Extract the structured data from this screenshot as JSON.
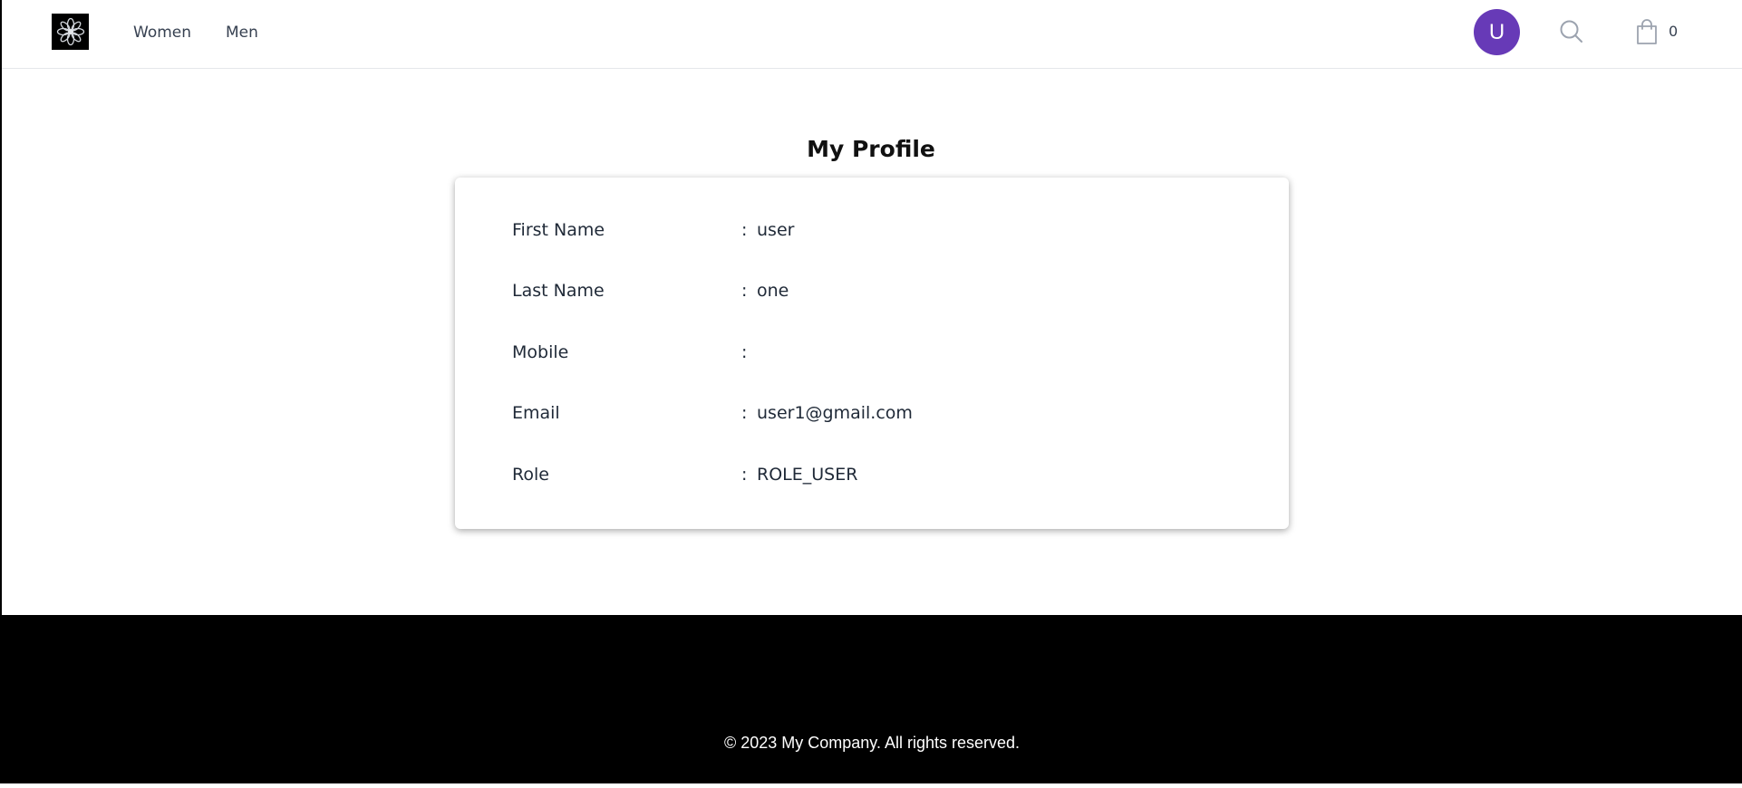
{
  "header": {
    "nav": [
      {
        "label": "Women"
      },
      {
        "label": "Men"
      }
    ],
    "avatar_initial": "U",
    "cart_count": "0",
    "icons": {
      "logo": "flower-logo-icon",
      "search": "search-icon",
      "cart": "shopping-bag-icon"
    }
  },
  "main": {
    "title": "My Profile",
    "fields": [
      {
        "label": "First Name",
        "separator": ":",
        "value": "user"
      },
      {
        "label": "Last Name",
        "separator": ":",
        "value": "one"
      },
      {
        "label": "Mobile",
        "separator": ":",
        "value": ""
      },
      {
        "label": "Email",
        "separator": ":",
        "value": "user1@gmail.com"
      },
      {
        "label": "Role",
        "separator": ":",
        "value": "ROLE_USER"
      }
    ]
  },
  "footer": {
    "copyright": "© 2023 My Company. All rights reserved."
  },
  "colors": {
    "avatar_bg": "#673ab7",
    "footer_bg": "#000000"
  }
}
